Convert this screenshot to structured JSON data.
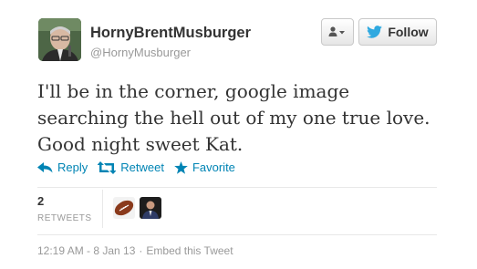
{
  "user": {
    "display_name": "HornyBrentMusburger",
    "handle": "@HornyMusburger"
  },
  "buttons": {
    "follow_label": "Follow"
  },
  "tweet": {
    "text": "I'll be in the corner, google image searching the hell out of my one true love. Good night sweet Kat."
  },
  "actions": {
    "reply": "Reply",
    "retweet": "Retweet",
    "favorite": "Favorite"
  },
  "stats": {
    "retweet_count": "2",
    "retweet_label": "RETWEETS"
  },
  "retweeters": [
    {
      "icon": "football-avatar"
    },
    {
      "icon": "person-avatar"
    }
  ],
  "footer": {
    "timestamp": "12:19 AM - 8 Jan 13",
    "embed": "Embed this Tweet"
  },
  "colors": {
    "link": "#0084b4",
    "twitter_blue": "#2fa9e0"
  }
}
